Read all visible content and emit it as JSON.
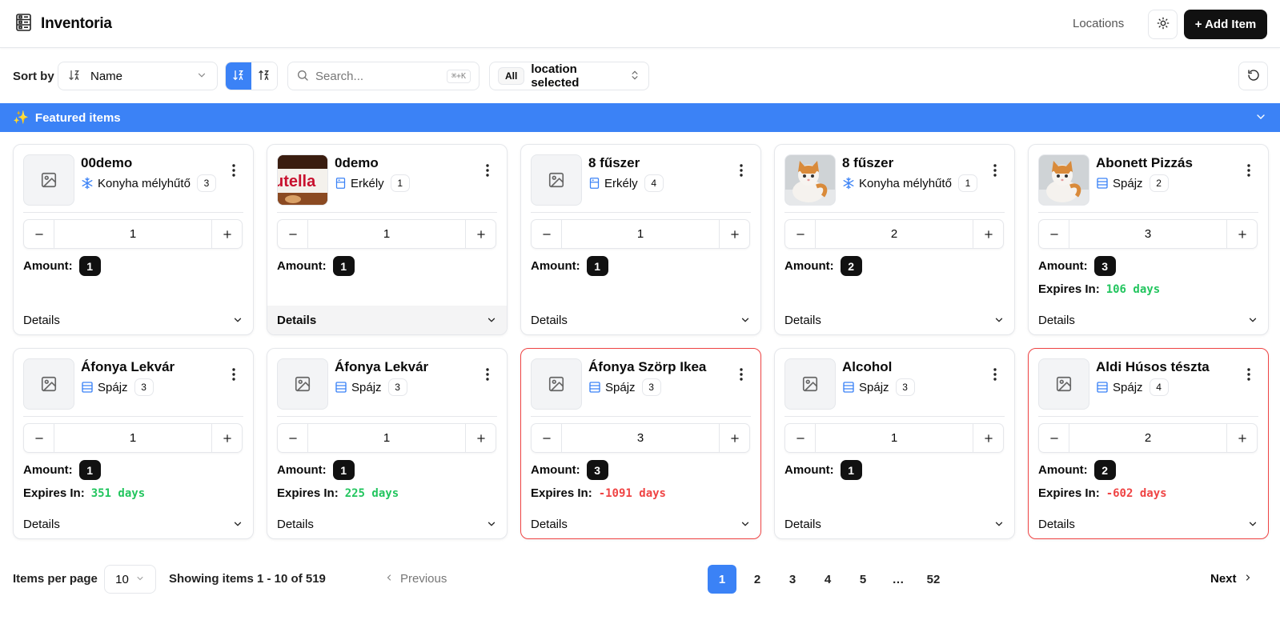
{
  "header": {
    "title": "Inventoria",
    "nav_locations": "Locations",
    "add_item_label": "+ Add Item"
  },
  "toolbar": {
    "sort_label": "Sort by",
    "sort_value": "Name",
    "search_placeholder": "Search...",
    "search_shortcut": "⌘+K",
    "location_all": "All",
    "location_text": "location selected"
  },
  "featured": {
    "icon": "✨",
    "title": "Featured items"
  },
  "colors": {
    "accent": "#3b82f6",
    "expires_ok": "#22c55e",
    "expires_bad": "#ef4444"
  },
  "labels": {
    "amount": "Amount:",
    "expires_in": "Expires In:",
    "details": "Details"
  },
  "items": [
    {
      "name": "00demo",
      "location_icon": "snowflake-icon",
      "location": "Konyha mélyhűtő",
      "location_count": "3",
      "quantity": "1",
      "amount": "1",
      "expires": "",
      "thumb": "placeholder"
    },
    {
      "name": "0demo",
      "location_icon": "cabinet-icon",
      "location": "Erkély",
      "location_count": "1",
      "quantity": "1",
      "amount": "1",
      "expires": "",
      "thumb": "nutella"
    },
    {
      "name": "8 fűszer",
      "location_icon": "cabinet-icon",
      "location": "Erkély",
      "location_count": "4",
      "quantity": "1",
      "amount": "1",
      "expires": "",
      "thumb": "placeholder"
    },
    {
      "name": "8 fűszer",
      "location_icon": "snowflake-icon",
      "location": "Konyha mélyhűtő",
      "location_count": "1",
      "quantity": "2",
      "amount": "2",
      "expires": "",
      "thumb": "cat"
    },
    {
      "name": "Abonett Pizzás",
      "location_icon": "shelf-icon",
      "location": "Spájz",
      "location_count": "2",
      "quantity": "3",
      "amount": "3",
      "expires": "106 days",
      "thumb": "cat"
    },
    {
      "name": "Áfonya Lekvár",
      "location_icon": "shelf-icon",
      "location": "Spájz",
      "location_count": "3",
      "quantity": "1",
      "amount": "1",
      "expires": "351 days",
      "thumb": "placeholder"
    },
    {
      "name": "Áfonya Lekvár",
      "location_icon": "shelf-icon",
      "location": "Spájz",
      "location_count": "3",
      "quantity": "1",
      "amount": "1",
      "expires": "225 days",
      "thumb": "placeholder"
    },
    {
      "name": "Áfonya Szörp Ikea",
      "location_icon": "shelf-icon",
      "location": "Spájz",
      "location_count": "3",
      "quantity": "3",
      "amount": "3",
      "expires": "-1091 days",
      "thumb": "placeholder"
    },
    {
      "name": "Alcohol",
      "location_icon": "shelf-icon",
      "location": "Spájz",
      "location_count": "3",
      "quantity": "1",
      "amount": "1",
      "expires": "",
      "thumb": "placeholder"
    },
    {
      "name": "Aldi Húsos tészta",
      "location_icon": "shelf-icon",
      "location": "Spájz",
      "location_count": "4",
      "quantity": "2",
      "amount": "2",
      "expires": "-602 days",
      "thumb": "placeholder"
    }
  ],
  "pagination": {
    "items_per_page_label": "Items per page",
    "items_per_page_value": "10",
    "showing_text": "Showing items 1 - 10 of 519",
    "previous_label": "Previous",
    "next_label": "Next",
    "pages": [
      "1",
      "2",
      "3",
      "4",
      "5",
      "…",
      "52"
    ],
    "current_page": "1"
  }
}
